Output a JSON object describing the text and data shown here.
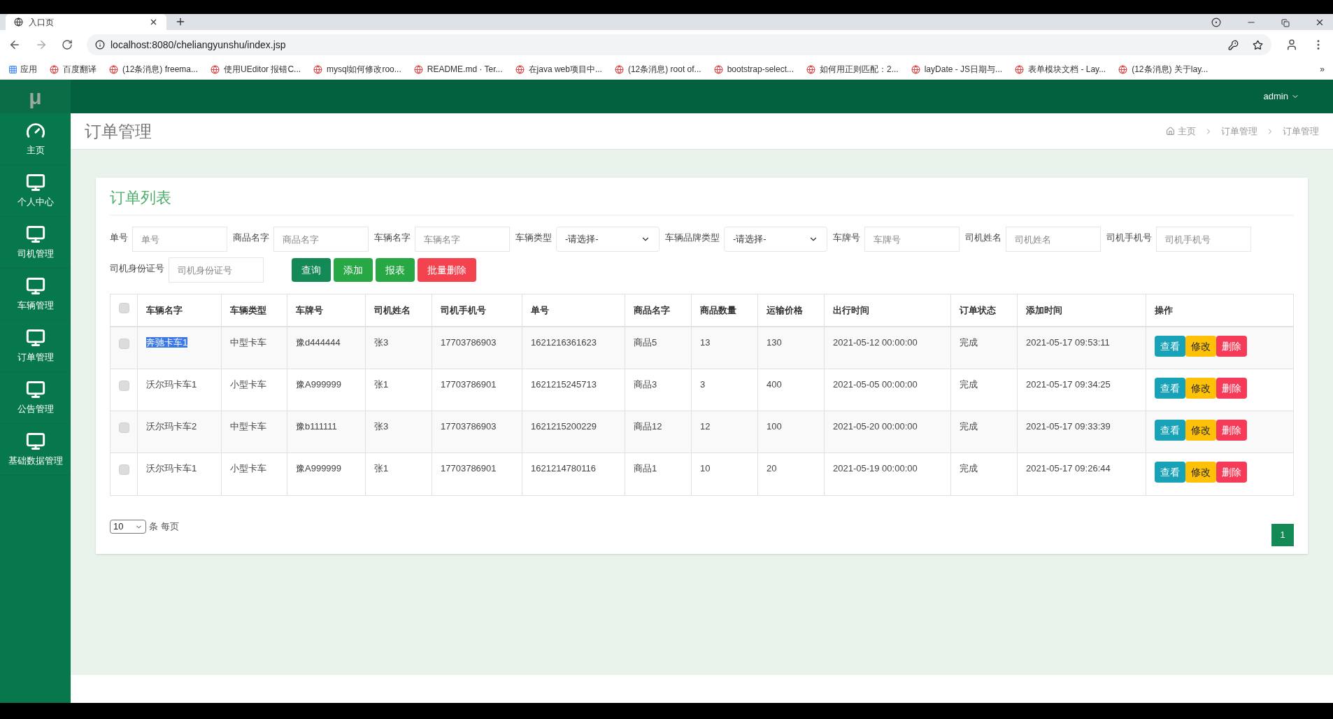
{
  "browser": {
    "tab_title": "入口页",
    "url": "localhost:8080/cheliangyunshu/index.jsp",
    "apps_label": "应用",
    "bookmarks": [
      "百度翻译",
      "(12条消息) freema...",
      "使用UEditor 报错C...",
      "mysql如何修改roo...",
      "README.md · Ter...",
      "在java web项目中...",
      "(12条消息) root of...",
      "bootstrap-select...",
      "如何用正则匹配：2...",
      "layDate - JS日期与...",
      "表单模块文档 - Lay...",
      "(12条消息) 关于lay..."
    ],
    "more": "»"
  },
  "sidebar": {
    "logo": "μ",
    "items": [
      {
        "label": "主页",
        "kind": "gauge"
      },
      {
        "label": "个人中心",
        "kind": "monitor"
      },
      {
        "label": "司机管理",
        "kind": "monitor"
      },
      {
        "label": "车辆管理",
        "kind": "monitor"
      },
      {
        "label": "订单管理",
        "kind": "monitor"
      },
      {
        "label": "公告管理",
        "kind": "monitor"
      },
      {
        "label": "基础数据管理",
        "kind": "monitor"
      }
    ]
  },
  "header": {
    "user": "admin"
  },
  "page": {
    "title": "订单管理",
    "breadcrumb": [
      "主页",
      "订单管理",
      "订单管理"
    ]
  },
  "card": {
    "title": "订单列表",
    "filters": [
      {
        "label": "单号",
        "kind": "input",
        "placeholder": "单号"
      },
      {
        "label": "商品名字",
        "kind": "input",
        "placeholder": "商品名字"
      },
      {
        "label": "车辆名字",
        "kind": "input",
        "placeholder": "车辆名字"
      },
      {
        "label": "车辆类型",
        "kind": "select",
        "value": "-请选择-"
      },
      {
        "label": "车辆品牌类型",
        "kind": "select",
        "value": "-请选择-"
      },
      {
        "label": "车牌号",
        "kind": "input",
        "placeholder": "车牌号"
      },
      {
        "label": "司机姓名",
        "kind": "input",
        "placeholder": "司机姓名"
      },
      {
        "label": "司机手机号",
        "kind": "input",
        "placeholder": "司机手机号"
      },
      {
        "label": "司机身份证号",
        "kind": "input",
        "placeholder": "司机身份证号"
      }
    ],
    "buttons": [
      {
        "label": "查询",
        "kind": "primary"
      },
      {
        "label": "添加",
        "kind": "success"
      },
      {
        "label": "报表",
        "kind": "success"
      },
      {
        "label": "批量删除",
        "kind": "danger"
      }
    ],
    "columns": [
      "车辆名字",
      "车辆类型",
      "车牌号",
      "司机姓名",
      "司机手机号",
      "单号",
      "商品名字",
      "商品数量",
      "运输价格",
      "出行时间",
      "订单状态",
      "添加时间",
      "操作"
    ],
    "header_checked": false,
    "rows": [
      {
        "checked": false,
        "name_highlighted": true,
        "cells": [
          "奔驰卡车1",
          "中型卡车",
          "豫d444444",
          "张3",
          "17703786903",
          "1621216361623",
          "商品5",
          "13",
          "130",
          "2021-05-12 00:00:00",
          "完成",
          "2021-05-17 09:53:11"
        ],
        "actions": [
          "查看",
          "修改",
          "删除"
        ]
      },
      {
        "checked": false,
        "name_highlighted": false,
        "cells": [
          "沃尔玛卡车1",
          "小型卡车",
          "豫A999999",
          "张1",
          "17703786901",
          "1621215245713",
          "商品3",
          "3",
          "400",
          "2021-05-05 00:00:00",
          "完成",
          "2021-05-17 09:34:25"
        ],
        "actions": [
          "查看",
          "修改",
          "删除"
        ]
      },
      {
        "checked": false,
        "name_highlighted": false,
        "cells": [
          "沃尔玛卡车2",
          "中型卡车",
          "豫b111111",
          "张3",
          "17703786903",
          "1621215200229",
          "商品12",
          "12",
          "100",
          "2021-05-20 00:00:00",
          "完成",
          "2021-05-17 09:33:39"
        ],
        "actions": [
          "查看",
          "修改",
          "删除"
        ]
      },
      {
        "checked": false,
        "name_highlighted": false,
        "cells": [
          "沃尔玛卡车1",
          "小型卡车",
          "豫A999999",
          "张1",
          "17703786901",
          "1621214780116",
          "商品1",
          "10",
          "20",
          "2021-05-19 00:00:00",
          "完成",
          "2021-05-17 09:26:44"
        ],
        "actions": [
          "查看",
          "修改",
          "删除"
        ]
      }
    ],
    "page_size": "10",
    "page_size_suffix": "条 每页",
    "pages": [
      {
        "label": "1",
        "selected": true
      }
    ]
  }
}
